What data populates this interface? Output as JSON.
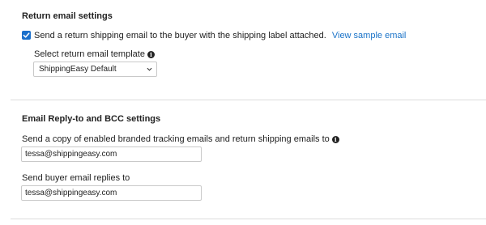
{
  "return_email": {
    "section_title": "Return email settings",
    "checkbox_checked": true,
    "checkbox_label": "Send a return shipping email to the buyer with the shipping label attached.",
    "sample_link": "View sample email",
    "template_label": "Select return email template",
    "template_selected": "ShippingEasy Default"
  },
  "reply_bcc": {
    "section_title": "Email Reply-to and BCC settings",
    "copy_label": "Send a copy of enabled branded tracking emails and return shipping emails to",
    "copy_value": "tessa@shippingeasy.com",
    "reply_label": "Send buyer email replies to",
    "reply_value": "tessa@shippingeasy.com"
  },
  "colors": {
    "accent": "#1a6fcb",
    "link": "#1a73c8",
    "divider": "#dcdcdc"
  },
  "icons": {
    "checkbox": "checkmark-icon",
    "info": "info-icon",
    "dropdown": "chevron-down-icon"
  }
}
